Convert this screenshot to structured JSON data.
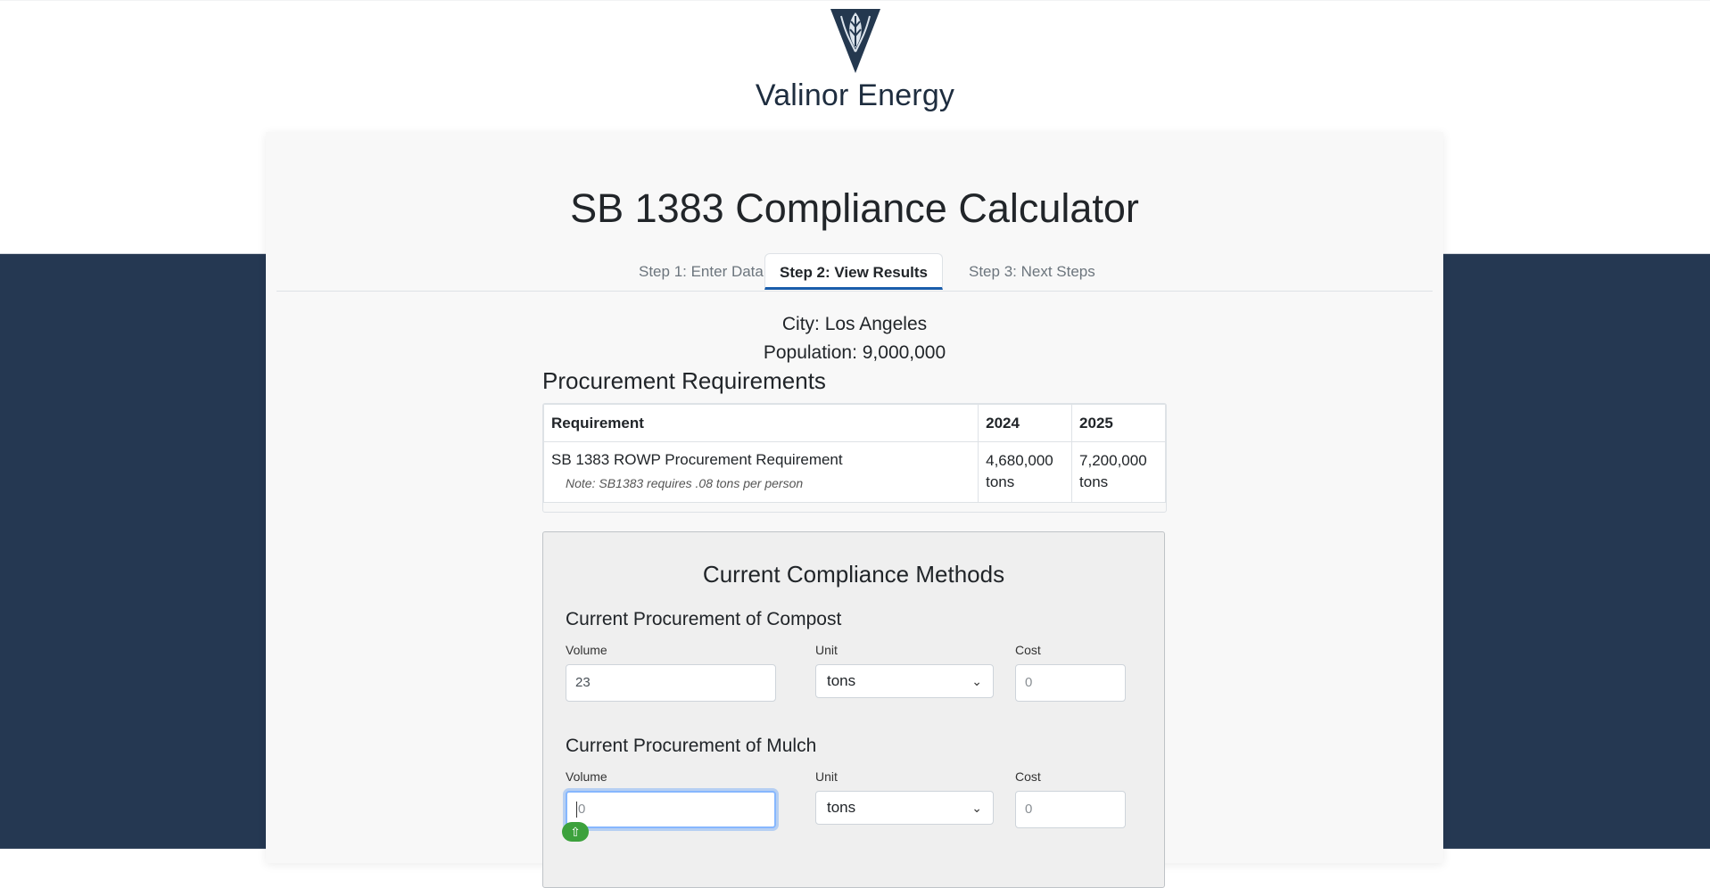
{
  "brand": {
    "name": "Valinor Energy",
    "logo_icon": "v-leaf-logo"
  },
  "page": {
    "title": "SB 1383 Compliance Calculator"
  },
  "tabs": [
    {
      "label": "Step 1: Enter Data"
    },
    {
      "label": "Step 2: View Results"
    },
    {
      "label": "Step 3: Next Steps"
    }
  ],
  "city": {
    "line": "City: Los Angeles",
    "population_line": "Population: 9,000,000"
  },
  "requirements": {
    "title": "Procurement Requirements",
    "headers": [
      "Requirement",
      "2024",
      "2025"
    ],
    "rows": [
      {
        "name": "SB 1383 ROWP Procurement Requirement",
        "note": "Note: SB1383 requires .08 tons per person",
        "y2024": "4,680,000 tons",
        "y2025": "7,200,000 tons"
      }
    ]
  },
  "methods": {
    "title": "Current Compliance Methods",
    "compost": {
      "title": "Current Procurement of Compost",
      "volume_label": "Volume",
      "volume_value": "23",
      "unit_label": "Unit",
      "unit_value": "tons",
      "cost_label": "Cost",
      "cost_placeholder": "0"
    },
    "mulch": {
      "title": "Current Procurement of Mulch",
      "volume_label": "Volume",
      "volume_placeholder": "0",
      "unit_label": "Unit",
      "unit_value": "tons",
      "cost_label": "Cost",
      "cost_placeholder": "0"
    }
  },
  "colors": {
    "header_bg": "#253852",
    "accent": "#1a5dab",
    "badge": "#3ca13c"
  }
}
